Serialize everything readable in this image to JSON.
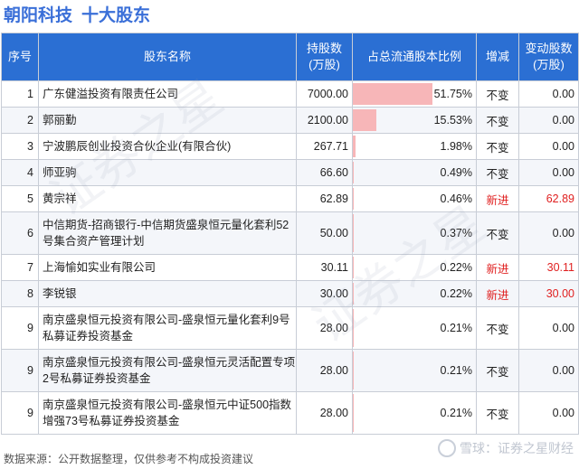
{
  "header": {
    "company": "朝阳科技",
    "subtitle": "十大股东"
  },
  "table": {
    "columns": [
      "序号",
      "股东名称",
      "持股数\n(万股)",
      "占总流通股本比例",
      "增减",
      "变动股数\n(万股)"
    ],
    "rows": [
      {
        "idx": "1",
        "name": "广东健溢投资有限责任公司",
        "shares": "7000.00",
        "ratio": "51.75%",
        "ratio_value": 51.75,
        "change": "不变",
        "delta": "0.00"
      },
      {
        "idx": "2",
        "name": "郭丽勤",
        "shares": "2100.00",
        "ratio": "15.53%",
        "ratio_value": 15.53,
        "change": "不变",
        "delta": "0.00"
      },
      {
        "idx": "3",
        "name": "宁波鹏辰创业投资合伙企业(有限合伙)",
        "shares": "267.71",
        "ratio": "1.98%",
        "ratio_value": 1.98,
        "change": "不变",
        "delta": "0.00"
      },
      {
        "idx": "4",
        "name": "师亚驹",
        "shares": "66.60",
        "ratio": "0.49%",
        "ratio_value": 0.49,
        "change": "不变",
        "delta": "0.00"
      },
      {
        "idx": "5",
        "name": "黄宗祥",
        "shares": "62.89",
        "ratio": "0.46%",
        "ratio_value": 0.46,
        "change": "新进",
        "delta": "62.89"
      },
      {
        "idx": "6",
        "name": "中信期货-招商银行-中信期货盛泉恒元量化套利52号集合资产管理计划",
        "shares": "50.00",
        "ratio": "0.37%",
        "ratio_value": 0.37,
        "change": "不变",
        "delta": "0.00"
      },
      {
        "idx": "7",
        "name": "上海愉如实业有限公司",
        "shares": "30.11",
        "ratio": "0.22%",
        "ratio_value": 0.22,
        "change": "新进",
        "delta": "30.11"
      },
      {
        "idx": "8",
        "name": "李锐银",
        "shares": "30.00",
        "ratio": "0.22%",
        "ratio_value": 0.22,
        "change": "新进",
        "delta": "30.00"
      },
      {
        "idx": "9",
        "name": "南京盛泉恒元投资有限公司-盛泉恒元量化套利9号私募证券投资基金",
        "shares": "28.00",
        "ratio": "0.21%",
        "ratio_value": 0.21,
        "change": "不变",
        "delta": "0.00"
      },
      {
        "idx": "9",
        "name": "南京盛泉恒元投资有限公司-盛泉恒元灵活配置专项2号私募证券投资基金",
        "shares": "28.00",
        "ratio": "0.21%",
        "ratio_value": 0.21,
        "change": "不变",
        "delta": "0.00"
      },
      {
        "idx": "9",
        "name": "南京盛泉恒元投资有限公司-盛泉恒元中证500指数增强73号私募证券投资基金",
        "shares": "28.00",
        "ratio": "0.21%",
        "ratio_value": 0.21,
        "change": "不变",
        "delta": "0.00"
      }
    ]
  },
  "footer": {
    "source": "数据来源：公开数据整理，仅供参考不构成投资建议"
  },
  "brand": {
    "text": "雪球：证券之星财经"
  },
  "colors": {
    "header_bg": "#2b6fd3",
    "title": "#3a6fd8",
    "bar": "#f7b6b8",
    "new": "#e02020"
  }
}
